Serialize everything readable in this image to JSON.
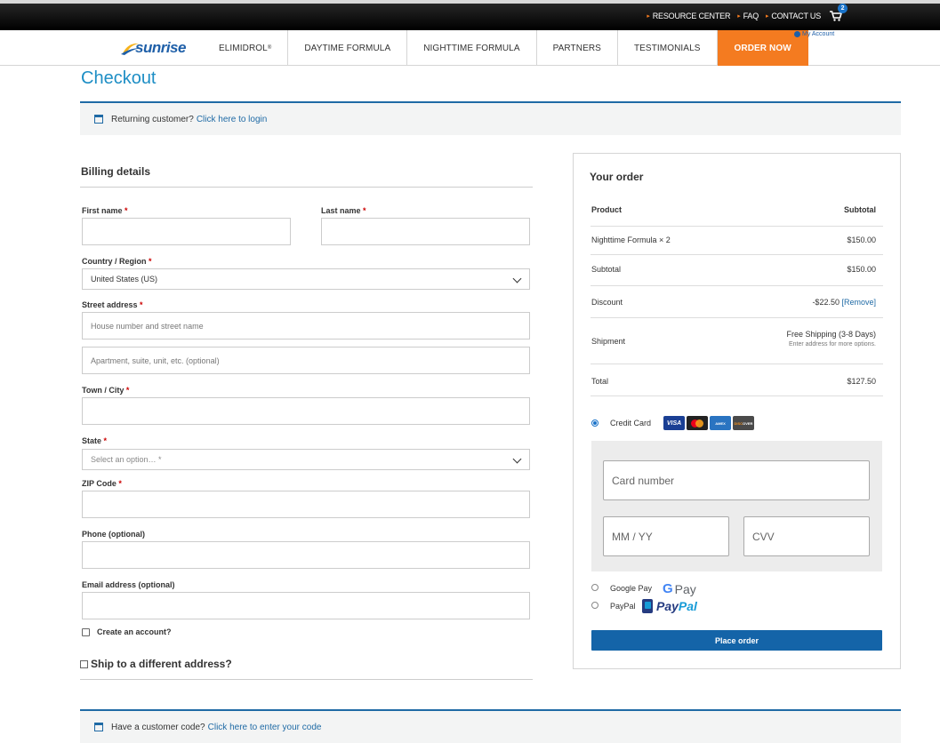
{
  "topbar": {
    "links": [
      "RESOURCE CENTER",
      "FAQ",
      "CONTACT US"
    ],
    "cart_count": "2"
  },
  "nav": {
    "logo_text": "sunrise",
    "items": [
      "ELIMIDROL",
      "DAYTIME FORMULA",
      "NIGHTTIME FORMULA",
      "PARTNERS",
      "TESTIMONIALS"
    ],
    "registered_mark": "®",
    "order_now": "ORDER NOW",
    "my_account": "My Account"
  },
  "page": {
    "title": "Checkout",
    "returning_text": "Returning customer?",
    "returning_link": "Click here to login",
    "code_text": "Have a customer code?",
    "code_link": "Click here to enter your code"
  },
  "billing": {
    "title": "Billing details",
    "first_name_label": "First name",
    "last_name_label": "Last name",
    "country_label": "Country / Region",
    "country_value": "United States (US)",
    "street_label": "Street address",
    "street_placeholder": "House number and street name",
    "apt_placeholder": "Apartment, suite, unit, etc. (optional)",
    "city_label": "Town / City",
    "state_label": "State",
    "state_placeholder": "Select an option… *",
    "zip_label": "ZIP Code",
    "phone_label": "Phone (optional)",
    "email_label": "Email address (optional)",
    "create_account": "Create an account?",
    "ship_different": "Ship to a different address?",
    "required_mark": "*"
  },
  "order": {
    "title": "Your order",
    "col_product": "Product",
    "col_subtotal": "Subtotal",
    "item_name": "Nighttime Formula",
    "item_qty": " × 2",
    "item_total": "$150.00",
    "subtotal_label": "Subtotal",
    "subtotal_value": "$150.00",
    "discount_label": "Discount",
    "discount_value": "-$22.50",
    "discount_remove": "[Remove]",
    "shipment_label": "Shipment",
    "shipment_value": "Free Shipping (3-8 Days)",
    "shipment_note": "Enter address for more options.",
    "total_label": "Total",
    "total_value": "$127.50"
  },
  "payment": {
    "credit_card": "Credit Card",
    "card_brands": [
      "VISA",
      "MasterCard",
      "AMERICAN EXPRESS",
      "DISCOVER"
    ],
    "card_number_placeholder": "Card number",
    "expiry_placeholder": "MM / YY",
    "cvv_placeholder": "CVV",
    "google_pay": "Google Pay",
    "gpay_logo": "Pay",
    "paypal": "PayPal",
    "paypal_logo_a": "Pay",
    "paypal_logo_b": "Pal",
    "place_order": "Place order"
  }
}
